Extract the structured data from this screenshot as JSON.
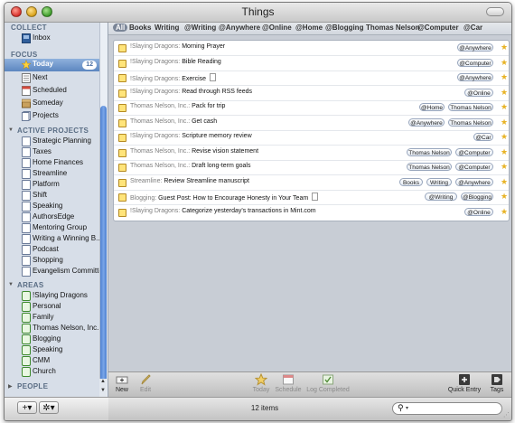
{
  "window": {
    "title": "Things"
  },
  "sidebar": {
    "collect_header": "COLLECT",
    "collect": [
      {
        "label": "Inbox"
      }
    ],
    "focus_header": "FOCUS",
    "focus": [
      {
        "label": "Today",
        "count": "12",
        "selected": true
      },
      {
        "label": "Next"
      },
      {
        "label": "Scheduled"
      },
      {
        "label": "Someday"
      },
      {
        "label": "Projects"
      }
    ],
    "projects_header": "ACTIVE PROJECTS",
    "projects": [
      {
        "label": "Strategic Planning"
      },
      {
        "label": "Taxes"
      },
      {
        "label": "Home Finances"
      },
      {
        "label": "Streamline"
      },
      {
        "label": "Platform"
      },
      {
        "label": "Shift"
      },
      {
        "label": "Speaking"
      },
      {
        "label": "AuthorsEdge"
      },
      {
        "label": "Mentoring Group"
      },
      {
        "label": "Writing a Winning B..."
      },
      {
        "label": "Podcast"
      },
      {
        "label": "Shopping"
      },
      {
        "label": "Evangelism Committee"
      }
    ],
    "areas_header": "AREAS",
    "areas": [
      {
        "label": "!Slaying Dragons"
      },
      {
        "label": "Personal"
      },
      {
        "label": "Family"
      },
      {
        "label": "Thomas Nelson, Inc."
      },
      {
        "label": "Blogging"
      },
      {
        "label": "Speaking"
      },
      {
        "label": "CMM"
      },
      {
        "label": "Church"
      }
    ],
    "people_header": "PEOPLE",
    "add_button": "+▾",
    "gear_button": "✲▾"
  },
  "tag_filter": [
    "All",
    "Books",
    "Writing",
    "@Writing",
    "@Anywhere",
    "@Online",
    "@Home",
    "@Blogging",
    "Thomas Nelson",
    "@Computer",
    "@Car"
  ],
  "tasks": [
    {
      "project": "!Slaying Dragons:",
      "title": "Morning Prayer",
      "note": false,
      "tags": [
        "@Anywhere"
      ]
    },
    {
      "project": "!Slaying Dragons:",
      "title": "Bible Reading",
      "note": false,
      "tags": [
        "@Computer"
      ]
    },
    {
      "project": "!Slaying Dragons:",
      "title": "Exercise",
      "note": true,
      "tags": [
        "@Anywhere"
      ]
    },
    {
      "project": "!Slaying Dragons:",
      "title": "Read through RSS feeds",
      "note": false,
      "tags": [
        "@Online"
      ]
    },
    {
      "project": "Thomas Nelson, Inc.:",
      "title": "Pack for trip",
      "note": false,
      "tags": [
        "@Home",
        "Thomas Nelson"
      ]
    },
    {
      "project": "Thomas Nelson, Inc.:",
      "title": "Get cash",
      "note": false,
      "tags": [
        "@Anywhere",
        "Thomas Nelson"
      ]
    },
    {
      "project": "!Slaying Dragons:",
      "title": "Scripture memory review",
      "note": false,
      "tags": [
        "@Car"
      ]
    },
    {
      "project": "Thomas Nelson, Inc.:",
      "title": "Revise vision statement",
      "note": false,
      "tags": [
        "Thomas Nelson",
        "@Computer"
      ]
    },
    {
      "project": "Thomas Nelson, Inc.:",
      "title": "Draft long-term goals",
      "note": false,
      "tags": [
        "Thomas Nelson",
        "@Computer"
      ]
    },
    {
      "project": "Streamline:",
      "title": "Review Streamline manuscript",
      "note": false,
      "tags": [
        "Books",
        "Writing",
        "@Anywhere"
      ]
    },
    {
      "project": "Blogging:",
      "title": "Guest Post: How to Encourage Honesty in Your Team",
      "note": true,
      "tags": [
        "@Writing",
        "@Blogging"
      ]
    },
    {
      "project": "!Slaying Dragons:",
      "title": "Categorize yesterday's transactions in Mint.com",
      "note": false,
      "tags": [
        "@Online"
      ]
    }
  ],
  "toolbar": {
    "new": "New",
    "edit": "Edit",
    "today": "Today",
    "schedule": "Schedule",
    "log_completed": "Log Completed",
    "quick_entry": "Quick Entry",
    "tags": "Tags"
  },
  "status": {
    "count": "12 items",
    "search_placeholder": ""
  }
}
